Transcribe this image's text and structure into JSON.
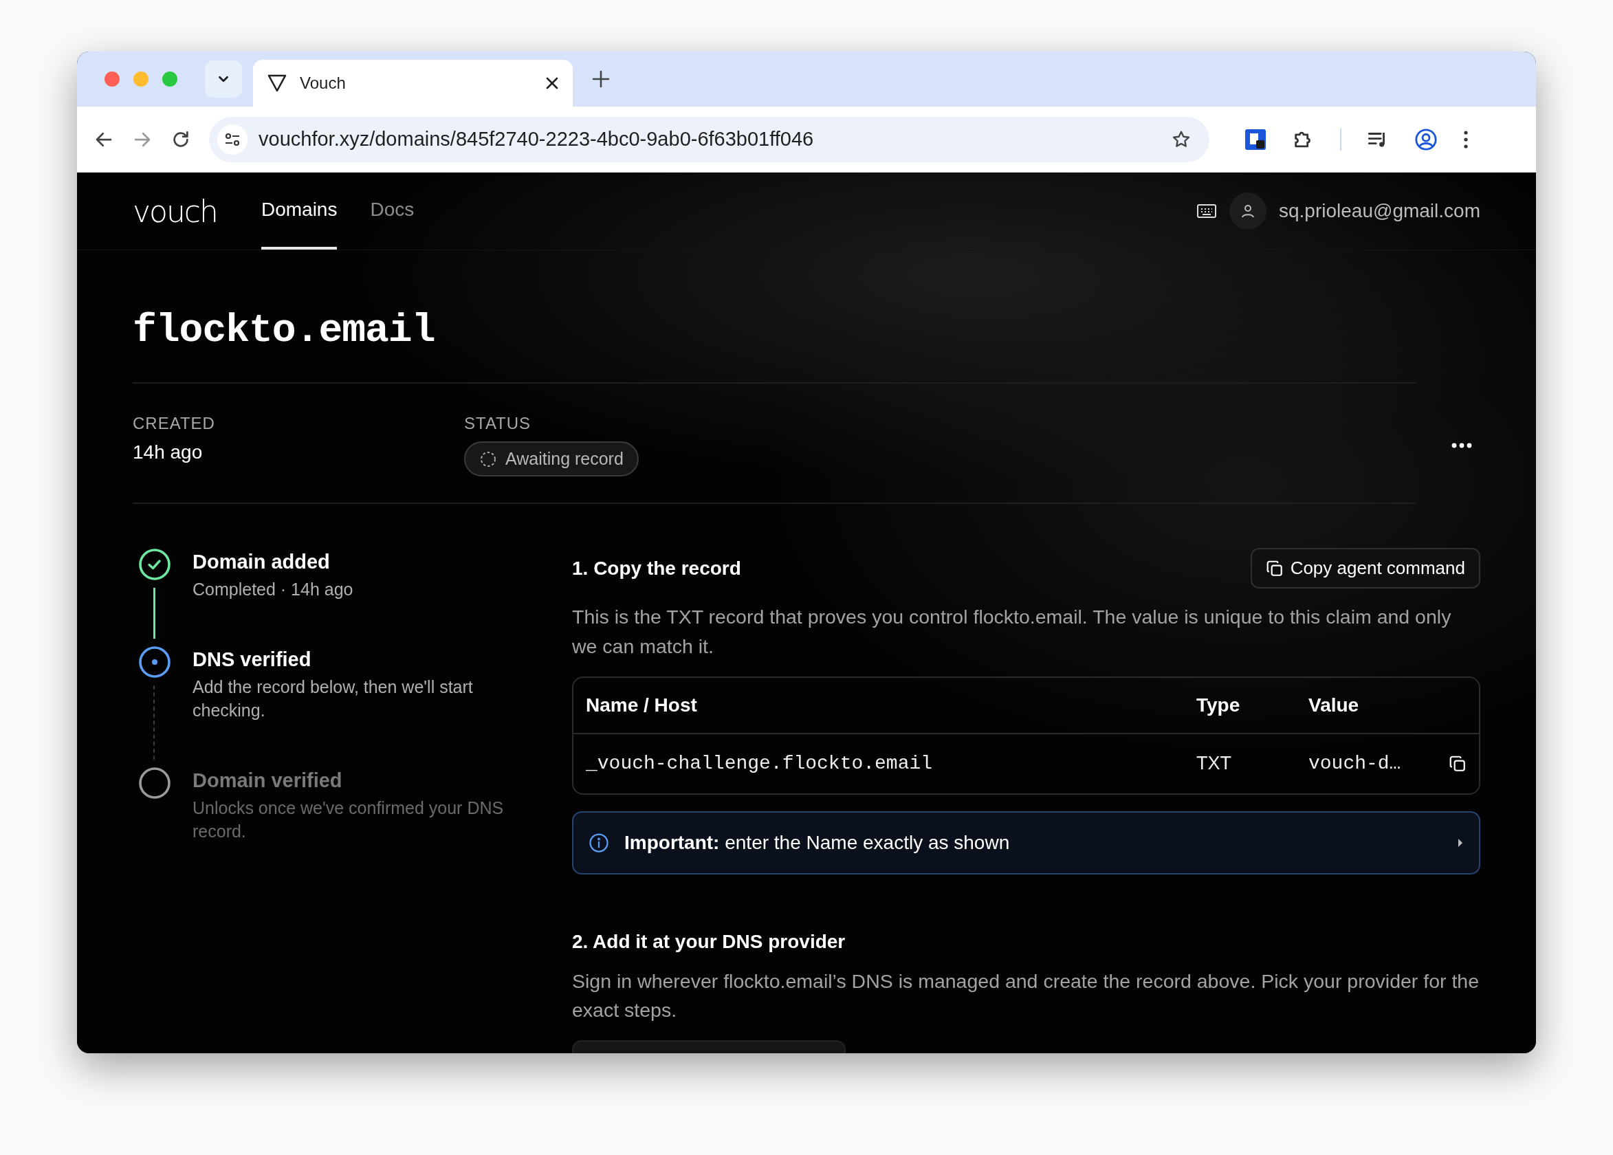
{
  "browser": {
    "tabs": [
      {
        "title": "Vouch",
        "selected": true
      }
    ],
    "url": "vouchfor.xyz/domains/845f2740-2223-4bc0-9ab0-6f63b01ff046"
  },
  "nav": {
    "logo": "vouch",
    "items": [
      {
        "label": "Domains",
        "selected": true
      },
      {
        "label": "Docs",
        "selected": false
      }
    ],
    "user_email": "sq.prioleau@gmail.com"
  },
  "domain": {
    "title": "flockto.email",
    "meta": [
      {
        "label": "CREATED",
        "value": "14h ago",
        "kind": "text"
      },
      {
        "label": "STATUS",
        "value": "Awaiting record",
        "kind": "pill"
      }
    ]
  },
  "steps": [
    {
      "title": "Domain added",
      "subtitle": "Completed · 14h ago",
      "kind": "done"
    },
    {
      "title": "DNS verified",
      "subtitle": "Add the record below, then we'll start checking.",
      "kind": "current"
    },
    {
      "title": "Domain verified",
      "subtitle": "Unlocks once we've confirmed your DNS record.",
      "kind": "pending"
    }
  ],
  "record_section": {
    "heading": "1. Copy the record",
    "button": "Copy agent command",
    "description": "This is the TXT record that proves you control flockto.email. The value is unique to this claim and only we can match it.",
    "table": {
      "columns": [
        "Name / Host",
        "Type",
        "Value"
      ],
      "rows": [
        [
          "_vouch-challenge.flockto.email",
          "TXT",
          "vouch-d…"
        ]
      ]
    },
    "callout": "**Important:** enter the Name exactly as shown"
  },
  "provider_section": {
    "heading": "2. Add it at your DNS provider",
    "description": "Sign in wherever flockto.email’s DNS is managed and create the record above. Pick your provider for the exact steps."
  }
}
